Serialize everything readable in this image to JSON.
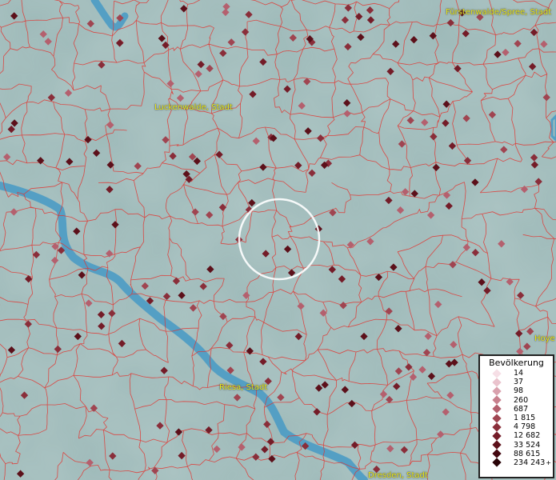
{
  "map": {
    "places": [
      {
        "name": "Fürstenwalde/Spree, Stadt",
        "pos": [
          557,
          18
        ]
      },
      {
        "name": "Luckenwalde, Stadt",
        "pos": [
          193,
          137
        ]
      },
      {
        "name": "Riesa, Stadt",
        "pos": [
          274,
          487
        ]
      },
      {
        "name": "Dresden, Stadt",
        "pos": [
          460,
          597
        ]
      },
      {
        "name": "Hoye",
        "pos": [
          668,
          426
        ]
      }
    ],
    "colors": {
      "land": "#9fbcbc",
      "water": "#4b9bc4",
      "borders": "#e2342f",
      "focus_ring": "#ffffff"
    }
  },
  "legend": {
    "title": "Bevölkerung",
    "classes": [
      {
        "label": "14",
        "color": "#f6dfe6"
      },
      {
        "label": "37",
        "color": "#eac3cd"
      },
      {
        "label": "98",
        "color": "#d9a1ad"
      },
      {
        "label": "260",
        "color": "#c8808d"
      },
      {
        "label": "687",
        "color": "#b4606e"
      },
      {
        "label": "1 815",
        "color": "#a04551"
      },
      {
        "label": "4 798",
        "color": "#8a2e3a"
      },
      {
        "label": "12 682",
        "color": "#741c28"
      },
      {
        "label": "33 524",
        "color": "#5c101a"
      },
      {
        "label": "88 615",
        "color": "#440810"
      },
      {
        "label": "234 243",
        "color": "#290307",
        "plus": "+"
      }
    ]
  }
}
